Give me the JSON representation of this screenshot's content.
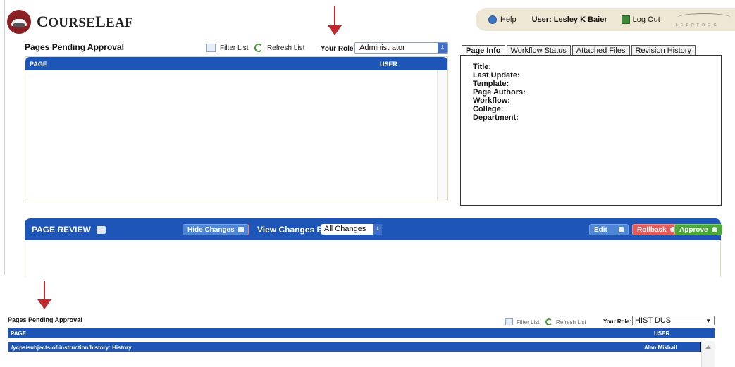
{
  "brand": {
    "name": "CourseLeaf"
  },
  "userbar": {
    "help": "Help",
    "user": "User: Lesley K Baier",
    "logout": "Log Out",
    "partner": "LEEPFROG"
  },
  "pending": {
    "title": "Pages Pending Approval",
    "filter": "Filter List",
    "refresh": "Refresh List",
    "role_label": "Your Role:",
    "role_value": "Administrator",
    "col_page": "PAGE",
    "col_user": "USER"
  },
  "tabs": [
    "Page Info",
    "Workflow Status",
    "Attached Files",
    "Revision History"
  ],
  "page_info": [
    "Title:",
    "Last Update:",
    "Template:",
    "Page Authors:",
    "Workflow:",
    "College:",
    "Department:"
  ],
  "review": {
    "title": "PAGE REVIEW",
    "hide_changes": "Hide Changes",
    "view_label": "View Changes By:",
    "view_value": "All Changes",
    "edit": "Edit",
    "rollback": "Rollback",
    "approve": "Approve"
  },
  "inset": {
    "title": "Pages Pending Approval",
    "filter": "Filter List",
    "refresh": "Refresh List",
    "role_label": "Your Role:",
    "role_value": "HIST DUS",
    "col_page": "PAGE",
    "col_user": "USER",
    "row": {
      "page": "/ycps/subjects-of-instruction/history: History",
      "user": "Alan Mikhail"
    }
  },
  "colors": {
    "header_blue": "#1e56b8",
    "arrow_red": "#c1272d",
    "rollback_red": "#e35b5b",
    "approve_green": "#4ba83a"
  }
}
